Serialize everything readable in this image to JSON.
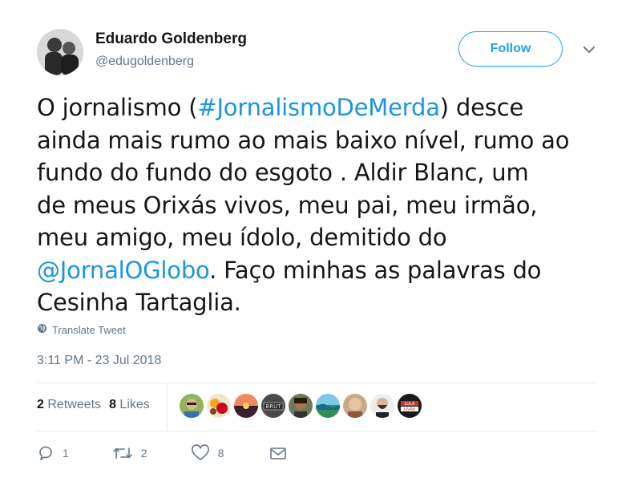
{
  "author": {
    "name": "Eduardo Goldenberg",
    "handle": "@edugoldenberg"
  },
  "follow_label": "Follow",
  "tweet": {
    "lines": [
      {
        "pre": "O jornalismo (",
        "link": "#JornalismoDeMerda",
        "post": ") desce"
      },
      {
        "pre": "ainda mais rumo ao mais baixo nível, rumo ao"
      },
      {
        "pre": "fundo do fundo do esgoto . Aldir Blanc, um"
      },
      {
        "pre": "de meus Orixás vivos, meu pai, meu irmão,"
      },
      {
        "pre": "meu amigo, meu ídolo, demitido do"
      },
      {
        "link": "@JornalOGlobo",
        "post": ". Faço minhas as palavras do"
      },
      {
        "pre": "Cesinha Tartaglia."
      }
    ]
  },
  "translate_label": "Translate Tweet",
  "timestamp": "3:11 PM - 23 Jul 2018",
  "stats": {
    "retweets_count": "2",
    "retweets_label": "Retweets",
    "likes_count": "8",
    "likes_label": "Likes"
  },
  "likers": [
    {
      "icon": "avatar-man-sunglasses"
    },
    {
      "icon": "avatar-flowers"
    },
    {
      "icon": "avatar-sunset"
    },
    {
      "icon": "avatar-brut-logo"
    },
    {
      "icon": "avatar-woman"
    },
    {
      "icon": "avatar-landscape"
    },
    {
      "icon": "avatar-older-woman"
    },
    {
      "icon": "avatar-man-beard"
    },
    {
      "icon": "avatar-lula-livre-logo"
    }
  ],
  "actions": {
    "reply_count": "1",
    "retweet_count": "2",
    "like_count": "8"
  },
  "colors": {
    "accent": "#1da1f2",
    "link": "#1b95e0",
    "muted": "#657786",
    "text": "#14171a"
  }
}
